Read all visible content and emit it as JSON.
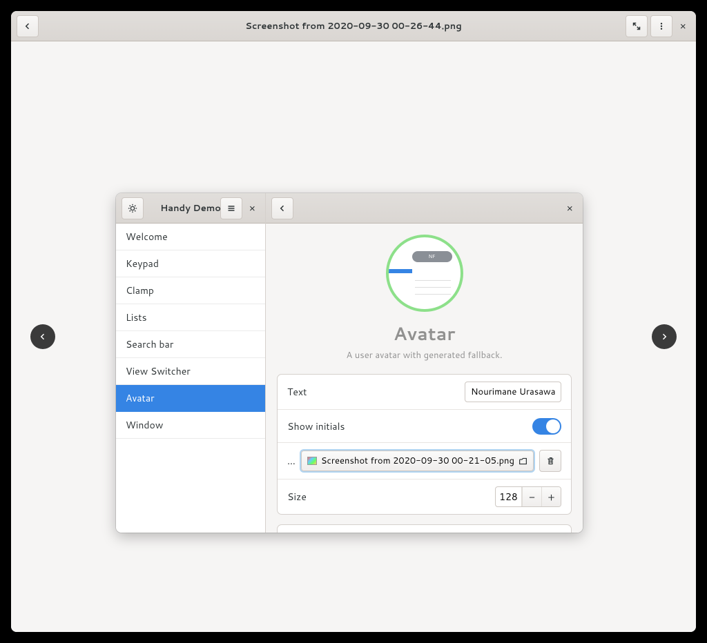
{
  "viewer": {
    "title": "Screenshot from 2020-09-30 00-26-44.png"
  },
  "inner": {
    "sidebar_title": "Handy Demo",
    "items": [
      {
        "label": "Welcome"
      },
      {
        "label": "Keypad"
      },
      {
        "label": "Clamp"
      },
      {
        "label": "Lists"
      },
      {
        "label": "Search bar"
      },
      {
        "label": "View Switcher"
      },
      {
        "label": "Avatar"
      },
      {
        "label": "Window"
      }
    ],
    "selected_index": 6
  },
  "content": {
    "title": "Avatar",
    "subtitle": "A user avatar with generated fallback.",
    "rows": {
      "text_label": "Text",
      "text_value": "Nourimane Urasawa",
      "show_initials_label": "Show initials",
      "show_initials_on": true,
      "file_label": "…",
      "file_name": "Screenshot from 2020-09-30 00-21-05.png",
      "size_label": "Size",
      "size_value": "128"
    },
    "avatar_badge": "NF"
  }
}
